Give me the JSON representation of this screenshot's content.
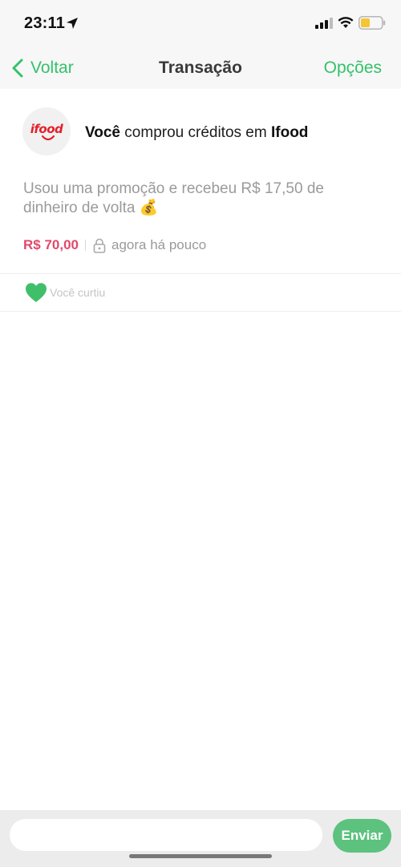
{
  "status_bar": {
    "time": "23:11",
    "location_icon": "location-arrow-icon",
    "signal_icon": "cellular-signal-icon",
    "wifi_icon": "wifi-icon",
    "battery_icon": "battery-icon",
    "battery_color": "#f4c534"
  },
  "nav": {
    "back_label": "Voltar",
    "title": "Transação",
    "options_label": "Opções",
    "accent_color": "#34c26a"
  },
  "transaction": {
    "logo_text": "ifood",
    "actor": "Você",
    "action": " comprou créditos em ",
    "merchant": "Ifood",
    "description": "Usou uma promoção e recebeu R$ 17,50 de dinheiro de volta 💰",
    "amount": "R$ 70,00",
    "amount_color": "#e0496b",
    "privacy_icon": "lock-icon",
    "time_ago": "agora há pouco"
  },
  "social": {
    "like_icon": "heart-icon",
    "like_color": "#3fbf6a",
    "liked_label": "Você curtiu"
  },
  "composer": {
    "input_value": "",
    "input_placeholder": "",
    "send_label": "Enviar"
  }
}
